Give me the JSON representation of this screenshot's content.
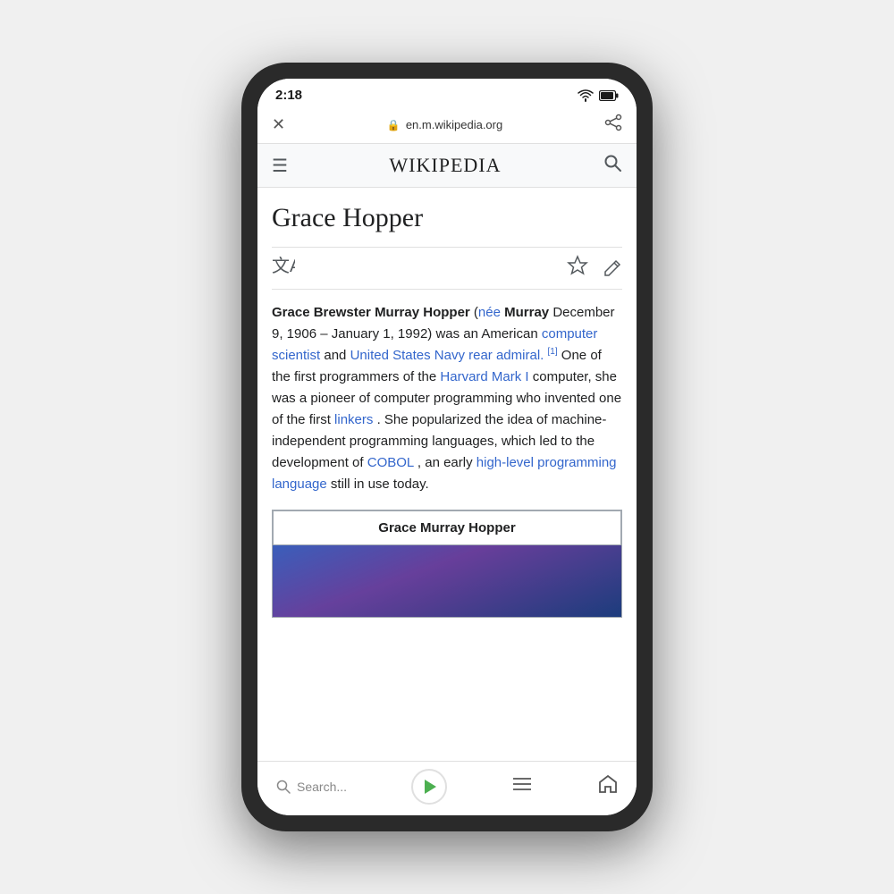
{
  "status": {
    "time": "2:18",
    "url": "en.m.wikipedia.org"
  },
  "wikipedia": {
    "title": "WIKIPEDIA",
    "article_title": "Grace Hopper",
    "article_intro_bold": "Grace Brewster Murray Hopper",
    "article_intro_italic": "née",
    "article_intro_text": " Murray December 9, 1906 – January 1, 1992) was an American ",
    "article_link1": "computer scientist",
    "article_text2": " and ",
    "article_link2": "United States Navy rear admiral.",
    "article_sup1": "[1]",
    "article_text3": " One of the first programmers of the ",
    "article_link3": "Harvard Mark I",
    "article_text4": " computer, she was a pioneer of computer programming who invented one of the first ",
    "article_link4": "linkers",
    "article_text5": ". She popularized the idea of machine-independent programming languages, which led to the development of ",
    "article_link5": "COBOL",
    "article_text6": ", an early ",
    "article_link6": "high-level programming language",
    "article_text7": " still in use today.",
    "infobox_name": "Grace Murray Hopper",
    "search_placeholder": "Search...",
    "nav": {
      "search_label": "Search...",
      "home_label": "Home"
    }
  }
}
